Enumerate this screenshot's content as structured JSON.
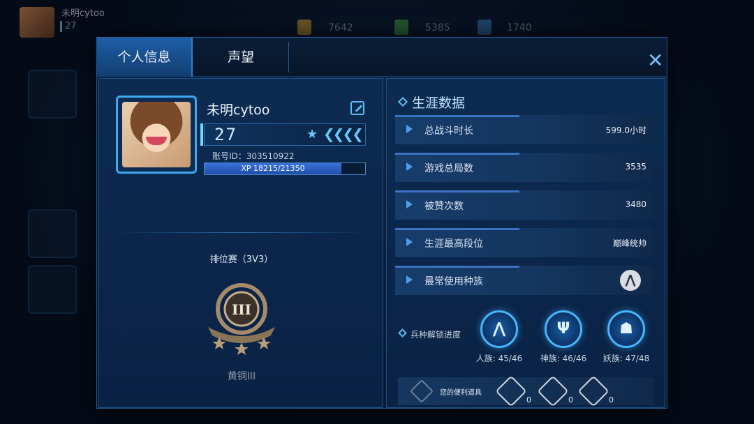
{
  "background": {
    "player_name": "未明cytoo",
    "level": "27",
    "resources": [
      "7642",
      "5385",
      "1740"
    ]
  },
  "tabs": [
    {
      "label": "个人信息",
      "active": true
    },
    {
      "label": "声望",
      "active": false
    }
  ],
  "profile": {
    "name": "未明cytoo",
    "level": "27",
    "account_id": "账号ID：303510922",
    "xp_text": "XP 18215/21350",
    "xp_fraction": 0.853
  },
  "ranked": {
    "title": "排位赛（3V3）",
    "tier": "黄铜III",
    "badge_roman": "III"
  },
  "career": {
    "title": "生涯数据",
    "stats": [
      {
        "label": "总战斗时长",
        "value": "599.0小时"
      },
      {
        "label": "游戏总局数",
        "value": "3535"
      },
      {
        "label": "被赞次数",
        "value": "3480"
      },
      {
        "label": "生涯最高段位",
        "value": "巅峰统帅"
      },
      {
        "label": "最常使用种族",
        "value": ""
      }
    ]
  },
  "unlock": {
    "label": "兵种解锁进度",
    "races": [
      {
        "progress": "人族: 45/46",
        "icon": "human-race-icon"
      },
      {
        "progress": "神族: 46/46",
        "icon": "god-race-icon"
      },
      {
        "progress": "妖族: 47/48",
        "icon": "demon-race-icon"
      }
    ]
  },
  "items": {
    "label": "您的便利道具",
    "counts": [
      "0",
      "0",
      "0"
    ]
  },
  "colors": {
    "accent": "#45b6ff",
    "panel": "#0d2b52",
    "tab_active": "#1e5fa6"
  }
}
